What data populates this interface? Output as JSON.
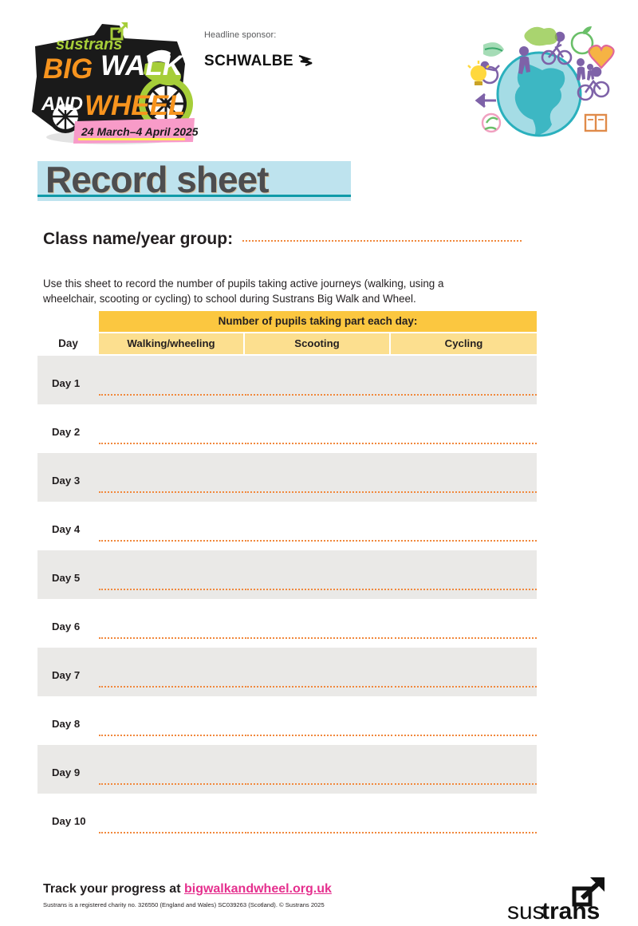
{
  "document": {
    "title": "Record sheet"
  },
  "header": {
    "logo": {
      "brand": "sustrans",
      "line1": "BIG",
      "line2": "WALK",
      "line3": "AND",
      "line4": "WHEEL",
      "dates": "24 March–4 April 2025"
    },
    "sponsor": {
      "label": "Headline sponsor:",
      "name_part1": "SCHW",
      "name_part2": "A",
      "name_part3": "LBE",
      "full_name": "SCHWALBE",
      "mark": "swoosh-arrow-icon"
    },
    "illustration": {
      "name": "globe-active-travel-illustration"
    }
  },
  "form": {
    "class_field": {
      "label": "Class name/year group:",
      "value": "",
      "placeholder": ""
    },
    "intro": "Use this sheet to record the number of pupils taking active journeys (walking, using a wheelchair, scooting or cycling) to school during Sustrans Big Walk and Wheel."
  },
  "table": {
    "group_header": "Number of pupils taking part each day:",
    "day_header": "Day",
    "columns": [
      "Walking/wheeling",
      "Scooting",
      "Cycling"
    ],
    "rows": [
      {
        "day": "Day 1",
        "walking": "",
        "scooting": "",
        "cycling": ""
      },
      {
        "day": "Day 2",
        "walking": "",
        "scooting": "",
        "cycling": ""
      },
      {
        "day": "Day 3",
        "walking": "",
        "scooting": "",
        "cycling": ""
      },
      {
        "day": "Day 4",
        "walking": "",
        "scooting": "",
        "cycling": ""
      },
      {
        "day": "Day 5",
        "walking": "",
        "scooting": "",
        "cycling": ""
      },
      {
        "day": "Day 6",
        "walking": "",
        "scooting": "",
        "cycling": ""
      },
      {
        "day": "Day 7",
        "walking": "",
        "scooting": "",
        "cycling": ""
      },
      {
        "day": "Day 8",
        "walking": "",
        "scooting": "",
        "cycling": ""
      },
      {
        "day": "Day 9",
        "walking": "",
        "scooting": "",
        "cycling": ""
      },
      {
        "day": "Day 10",
        "walking": "",
        "scooting": "",
        "cycling": ""
      }
    ]
  },
  "footer": {
    "track_prefix": "Track your progress at ",
    "track_url": "bigwalkandwheel.org.uk",
    "charity": "Sustrans is a registered charity no. 326550 (England and Wales) SC039263 (Scotland). © Sustrans 2025",
    "logo": {
      "light": "sus",
      "bold": "trans",
      "mark": "arrow-out-of-box-icon"
    }
  },
  "colors": {
    "group_header_bg": "#fbc740",
    "column_header_bg": "#fcdf8f",
    "row_shaded_bg": "#eae9e7",
    "dotted_line": "#f1883c",
    "title_highlight": "#bee3ee",
    "title_rule": "#109aa8",
    "title_text": "#4d4d4f",
    "link": "#e5308e",
    "logo_orange": "#f7941e",
    "logo_green": "#a6ce39",
    "logo_pink": "#f89bc8"
  }
}
